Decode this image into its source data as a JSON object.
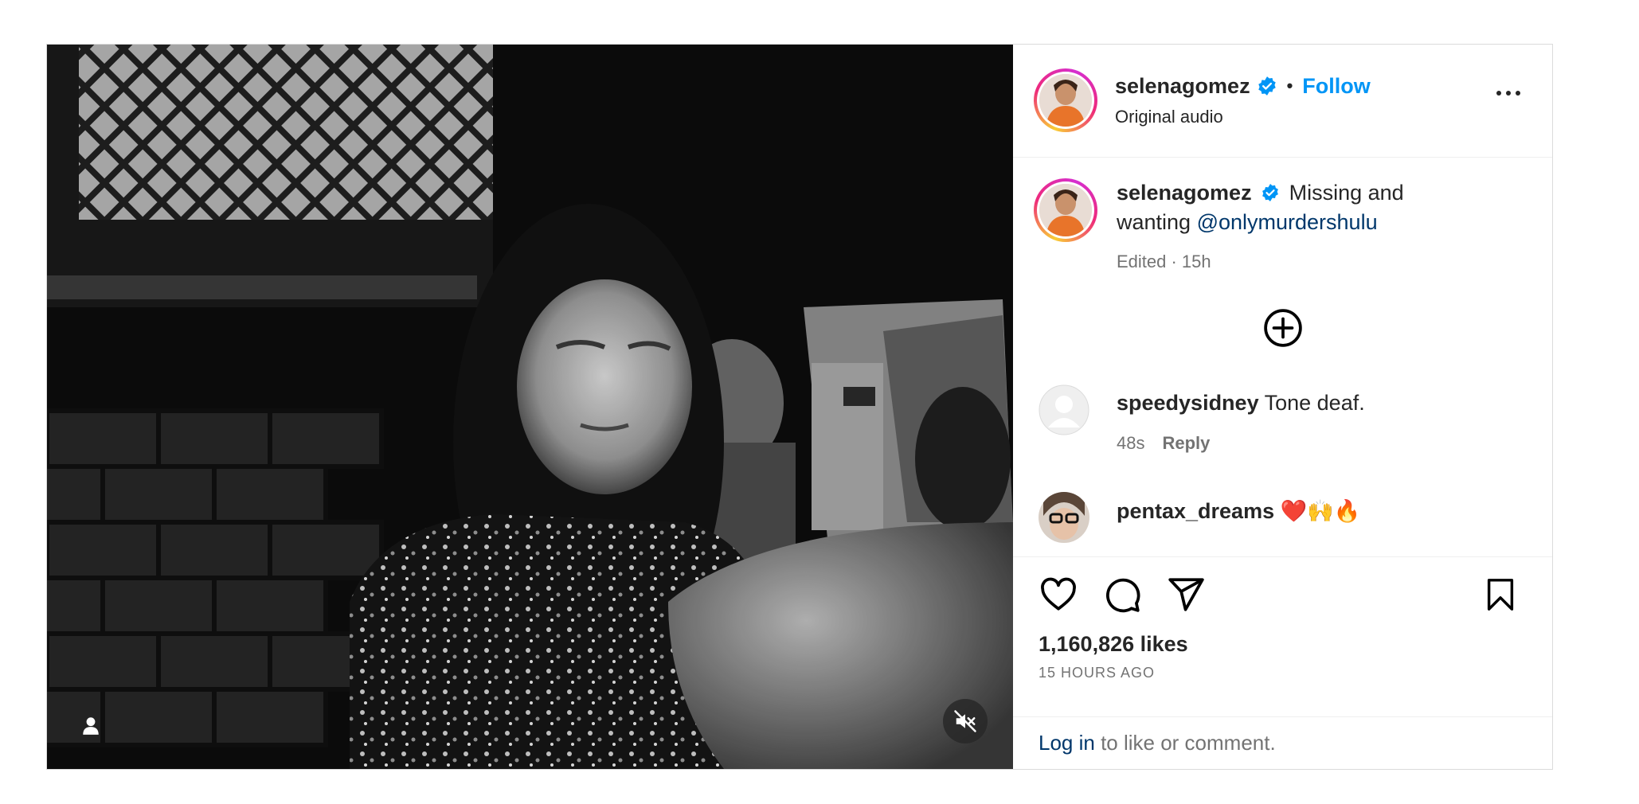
{
  "post": {
    "username": "selenagomez",
    "follow_label": "Follow",
    "audio_label": "Original audio",
    "caption": {
      "username": "selenagomez",
      "text": "Missing and wanting ",
      "mention": "@onlymurdershulu",
      "meta": "Edited · 15h"
    },
    "comments": [
      {
        "username": "speedysidney",
        "text": "Tone deaf.",
        "time": "48s",
        "reply_label": "Reply"
      },
      {
        "username": "pentax_dreams",
        "text": "❤️🙌🔥"
      }
    ],
    "likes": "1,160,826 likes",
    "timestamp": "15 HOURS AGO",
    "login_link": "Log in",
    "login_text": " to like or comment."
  },
  "icons": {
    "verified": "verified-badge-icon",
    "more": "more-options-icon",
    "add_comment": "plus-circle-icon",
    "like": "heart-icon",
    "comment": "comment-bubble-icon",
    "share": "send-icon",
    "save": "bookmark-icon",
    "tag": "user-tag-icon",
    "mute": "muted-speaker-icon"
  },
  "colors": {
    "follow": "#0095f6",
    "verified": "#0095f6",
    "mention": "#00376b",
    "muted_text": "#737373"
  }
}
